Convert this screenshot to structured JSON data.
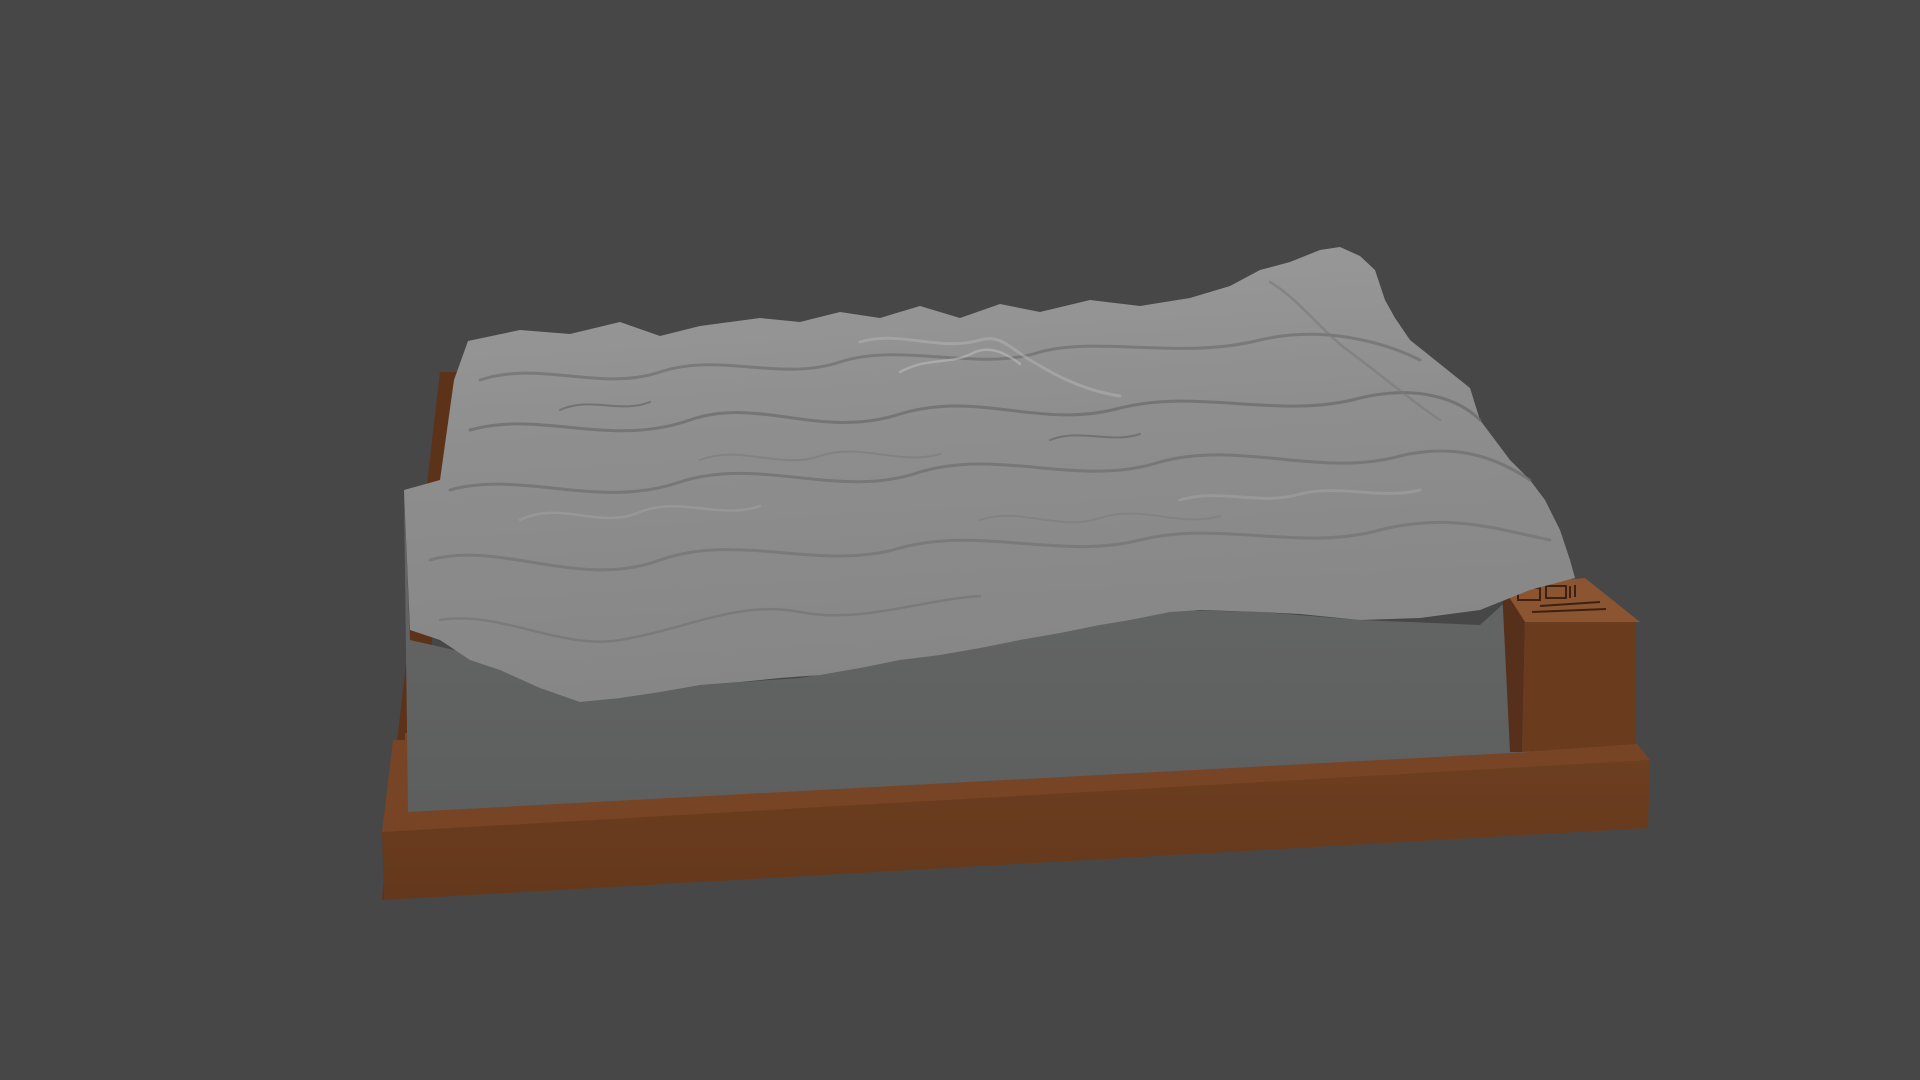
{
  "viewport": {
    "background_color": "#474747"
  },
  "model": {
    "terrain_color": "#8f8f8f",
    "terrain_side_color": "#5f6060",
    "base_color": "#6b3c1f",
    "base_dark_color": "#56301a",
    "base_top_color": "#7a4626"
  },
  "label_block": {
    "icon": "engraved-label-icon"
  }
}
